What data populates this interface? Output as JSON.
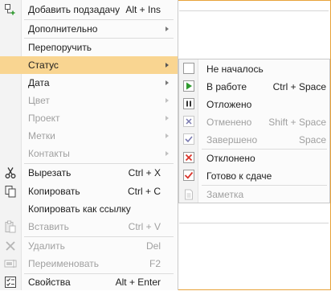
{
  "main_menu": {
    "add_subtask": {
      "label": "Добавить подзадачу",
      "shortcut": "Alt + Ins"
    },
    "additional": {
      "label": "Дополнительно"
    },
    "reassign": {
      "label": "Перепоручить"
    },
    "status": {
      "label": "Статус"
    },
    "date": {
      "label": "Дата"
    },
    "color": {
      "label": "Цвет"
    },
    "project": {
      "label": "Проект"
    },
    "tags": {
      "label": "Метки"
    },
    "contacts": {
      "label": "Контакты"
    },
    "cut": {
      "label": "Вырезать",
      "shortcut": "Ctrl + X"
    },
    "copy": {
      "label": "Копировать",
      "shortcut": "Ctrl + C"
    },
    "copy_link": {
      "label": "Копировать как ссылку"
    },
    "paste": {
      "label": "Вставить",
      "shortcut": "Ctrl + V"
    },
    "delete": {
      "label": "Удалить",
      "shortcut": "Del"
    },
    "rename": {
      "label": "Переименовать",
      "shortcut": "F2"
    },
    "properties": {
      "label": "Свойства",
      "shortcut": "Alt + Enter"
    }
  },
  "status_submenu": {
    "not_started": {
      "label": "Не началось"
    },
    "in_progress": {
      "label": "В работе",
      "shortcut": "Ctrl + Space"
    },
    "postponed": {
      "label": "Отложено"
    },
    "cancelled": {
      "label": "Отменено",
      "shortcut": "Shift + Space"
    },
    "completed": {
      "label": "Завершено",
      "shortcut": "Space"
    },
    "rejected": {
      "label": "Отклонено"
    },
    "ready": {
      "label": "Готово к сдаче"
    },
    "note": {
      "label": "Заметка"
    }
  },
  "colors": {
    "highlight": "#f9d591",
    "accent_green": "#2e9a2e",
    "accent_red": "#d9342b",
    "disabled": "#a0a0a0"
  }
}
